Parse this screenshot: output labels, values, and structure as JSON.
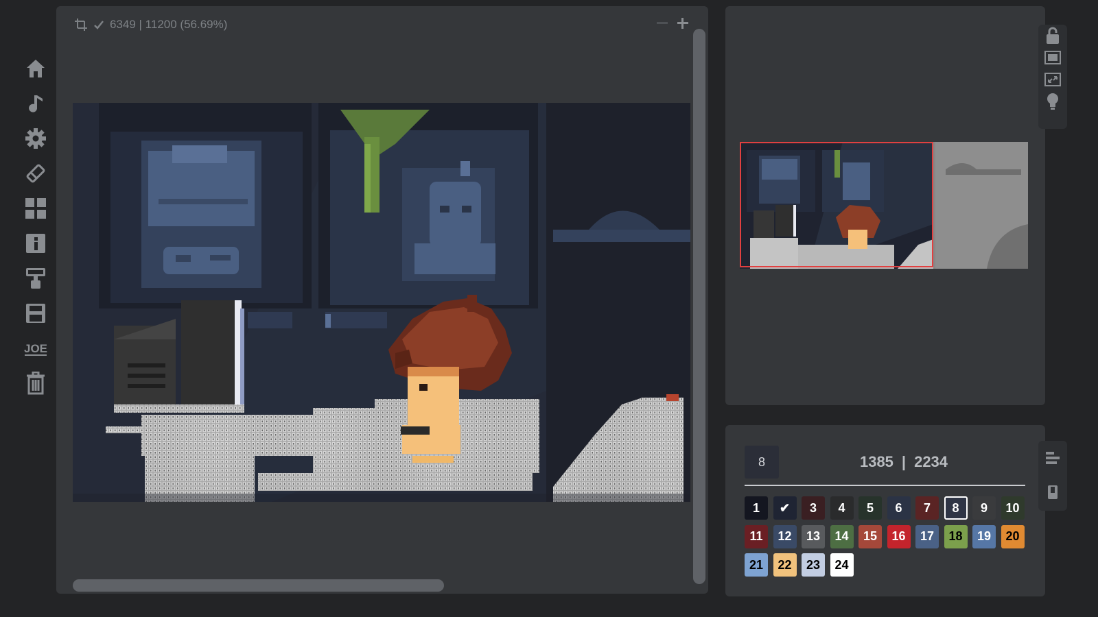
{
  "sidebar": {
    "items": [
      {
        "icon": "home-icon"
      },
      {
        "icon": "music-note-icon"
      },
      {
        "icon": "gear-icon"
      },
      {
        "icon": "eraser-icon"
      },
      {
        "icon": "grid-icon"
      },
      {
        "icon": "info-icon"
      },
      {
        "icon": "brush-icon"
      },
      {
        "icon": "save-icon"
      },
      {
        "icon": "joe-logo-icon",
        "label": "JOE"
      },
      {
        "icon": "trash-icon"
      }
    ]
  },
  "canvas": {
    "status_text": "6349 | 11200 (56.69%)",
    "progress_fraction": 0.5669
  },
  "preview": {
    "tools": [
      "lock-icon",
      "fit-screen-icon",
      "fullscreen-icon",
      "lightbulb-icon"
    ]
  },
  "palette": {
    "selected": "8",
    "filled": "1385",
    "separator": "|",
    "total": "2234",
    "swatches": [
      {
        "label": "1",
        "bg": "#141620",
        "fg": "#ffffff"
      },
      {
        "label": "✔",
        "bg": "#1f2433",
        "fg": "#ffffff"
      },
      {
        "label": "3",
        "bg": "#3a1f22",
        "fg": "#ffffff"
      },
      {
        "label": "4",
        "bg": "#2a2b2c",
        "fg": "#ffffff"
      },
      {
        "label": "5",
        "bg": "#27332b",
        "fg": "#ffffff"
      },
      {
        "label": "6",
        "bg": "#2b3345",
        "fg": "#ffffff"
      },
      {
        "label": "7",
        "bg": "#5a2424",
        "fg": "#ffffff"
      },
      {
        "label": "8",
        "bg": "#2f3545",
        "fg": "#ffffff",
        "selected": true
      },
      {
        "label": "9",
        "bg": "#3a3b3d",
        "fg": "#ffffff"
      },
      {
        "label": "10",
        "bg": "#2f3a2c",
        "fg": "#ffffff"
      },
      {
        "label": "11",
        "bg": "#6a1f24",
        "fg": "#ffffff"
      },
      {
        "label": "12",
        "bg": "#3a4a66",
        "fg": "#ffffff"
      },
      {
        "label": "13",
        "bg": "#585a5d",
        "fg": "#ffffff"
      },
      {
        "label": "14",
        "bg": "#4d6e43",
        "fg": "#ffffff"
      },
      {
        "label": "15",
        "bg": "#a5483a",
        "fg": "#ffffff"
      },
      {
        "label": "16",
        "bg": "#c4242c",
        "fg": "#ffffff"
      },
      {
        "label": "17",
        "bg": "#4a6186",
        "fg": "#ffffff"
      },
      {
        "label": "18",
        "bg": "#7ca04c",
        "fg": "#000000"
      },
      {
        "label": "19",
        "bg": "#5677a6",
        "fg": "#ffffff"
      },
      {
        "label": "20",
        "bg": "#e08a32",
        "fg": "#000000"
      },
      {
        "label": "21",
        "bg": "#7ea3d2",
        "fg": "#000000"
      },
      {
        "label": "22",
        "bg": "#f1c27d",
        "fg": "#000000"
      },
      {
        "label": "23",
        "bg": "#c2cde2",
        "fg": "#000000"
      },
      {
        "label": "24",
        "bg": "#ffffff",
        "fg": "#000000"
      }
    ]
  },
  "palette_tools": [
    "align-icon",
    "paint-bucket-icon"
  ],
  "colors": {
    "background": "#232426",
    "panel": "#35373a",
    "accent_frame": "#e04040"
  }
}
